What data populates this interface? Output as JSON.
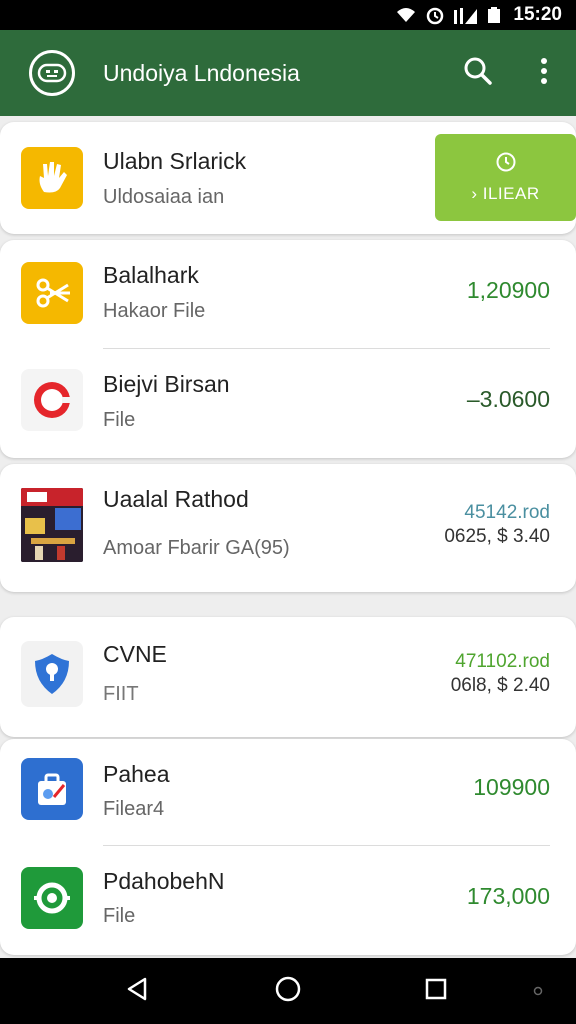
{
  "status_bar": {
    "time": "15:20"
  },
  "app_bar": {
    "title": "Undoiya Lndonesia"
  },
  "card1": {
    "name": "Ulabn Srlarick",
    "sub": "Uldosaiaa ian",
    "button_label": "› ILIEAR"
  },
  "card2": {
    "items": [
      {
        "name": "Balalhark",
        "sub": "Hakaor File",
        "value": "1,20900"
      },
      {
        "name": "Biejvi Birsan",
        "sub": "File",
        "value": "–3.0600"
      }
    ]
  },
  "card3": {
    "name": "Uaalal Rathod",
    "sub": "Amoar Fbarir GA(95)",
    "value_primary": "45142.rod",
    "value_secondary": "0625, $ 3.40"
  },
  "card4": {
    "name": "CVNE",
    "sub": "FIIT",
    "value_primary": "471102.rod",
    "value_secondary": "06l8, $ 2.40"
  },
  "card5": {
    "items": [
      {
        "name": "Pahea",
        "sub": "Filear4",
        "value": "109900"
      },
      {
        "name": "PdahobehN",
        "sub": "File",
        "value": "173,000"
      }
    ]
  },
  "colors": {
    "app_bar": "#2e6b3b",
    "accent_button": "#8cc63f",
    "value_green": "#2f8a2f",
    "value_teal": "#4a8fa0"
  },
  "icons": [
    "wifi-icon",
    "alarm-icon",
    "signal-icon",
    "battery-icon",
    "app-logo-icon",
    "search-icon",
    "more-vert-icon",
    "hand-app-icon",
    "scissors-app-icon",
    "circle-app-icon",
    "photo-thumbnail",
    "shield-app-icon",
    "bag-app-icon",
    "lens-app-icon",
    "clock-icon",
    "back-icon",
    "home-icon",
    "recents-icon"
  ]
}
